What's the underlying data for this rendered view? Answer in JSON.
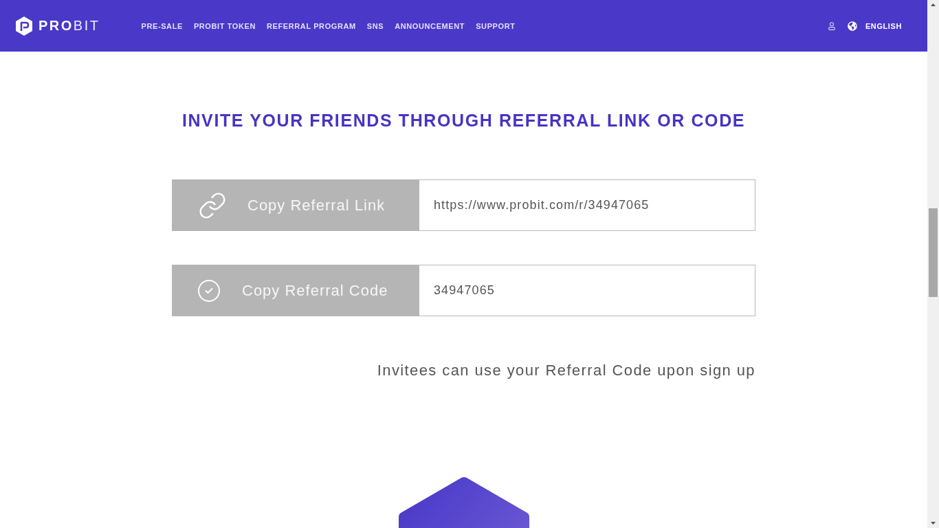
{
  "header": {
    "logo": "**PRO**BIT",
    "nav": [
      {
        "label": "PRE-SALE"
      },
      {
        "label": "PROBIT TOKEN"
      },
      {
        "label": "REFERRAL PROGRAM"
      },
      {
        "label": "SNS"
      },
      {
        "label": "ANNOUNCEMENT"
      },
      {
        "label": "SUPPORT"
      }
    ],
    "language": "ENGLISH"
  },
  "referral": {
    "title": "INVITE YOUR FRIENDS THROUGH REFERRAL LINK OR CODE",
    "rows": [
      {
        "kind": "link",
        "button": "Copy Referral Link",
        "value": "https://www.probit.com/r/34947065"
      },
      {
        "kind": "code",
        "button": "Copy Referral Code",
        "value": "34947065"
      }
    ],
    "note": "Invitees can use your Referral Code upon sign up"
  }
}
